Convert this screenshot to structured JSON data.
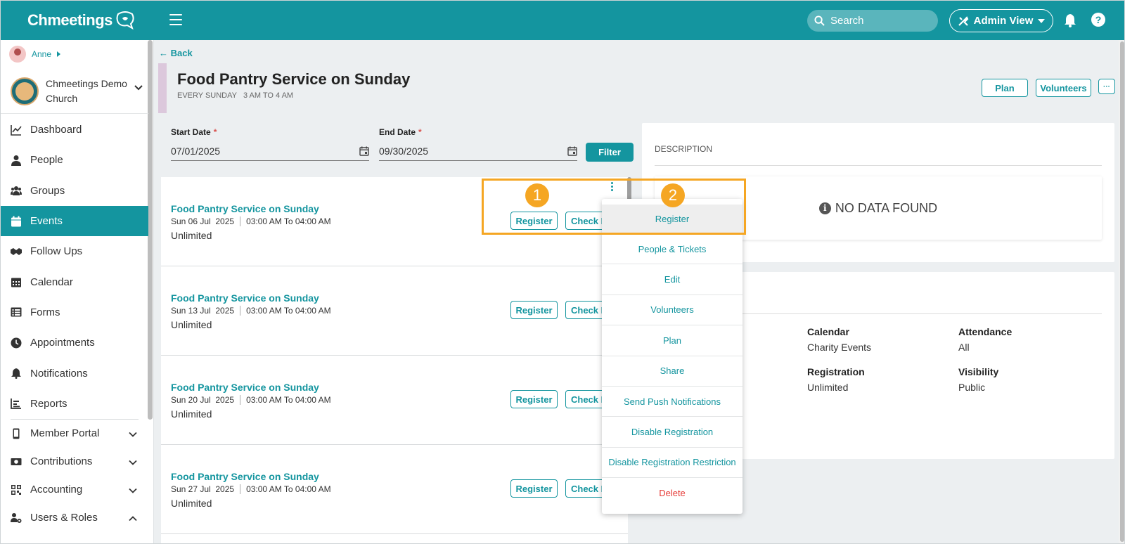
{
  "app": {
    "name": "Chmeetings"
  },
  "topbar": {
    "search_placeholder": "Search",
    "admin_view_label": "Admin View"
  },
  "user": {
    "name": "Anne"
  },
  "church": {
    "name": "Chmeetings Demo Church"
  },
  "nav": {
    "items": [
      {
        "label": "Dashboard",
        "icon": "chart-line-icon"
      },
      {
        "label": "People",
        "icon": "person-icon"
      },
      {
        "label": "Groups",
        "icon": "users-icon"
      },
      {
        "label": "Events",
        "icon": "calendar-icon",
        "active": true
      },
      {
        "label": "Follow Ups",
        "icon": "handshake-icon"
      },
      {
        "label": "Calendar",
        "icon": "calendar-grid-icon"
      },
      {
        "label": "Forms",
        "icon": "list-icon"
      },
      {
        "label": "Appointments",
        "icon": "clock-icon"
      },
      {
        "label": "Notifications",
        "icon": "bell-icon"
      },
      {
        "label": "Reports",
        "icon": "report-icon"
      }
    ],
    "sections": [
      {
        "label": "Member Portal",
        "icon": "phone-icon",
        "expanded": false
      },
      {
        "label": "Contributions",
        "icon": "money-icon",
        "expanded": false
      },
      {
        "label": "Accounting",
        "icon": "qr-icon",
        "expanded": false
      },
      {
        "label": "Users & Roles",
        "icon": "users-cog-icon",
        "expanded": true
      }
    ]
  },
  "page": {
    "back_label": "Back",
    "title": "Food Pantry Service on Sunday",
    "subtitle": "EVERY SUNDAY   3 AM TO 4 AM",
    "header_buttons": {
      "plan": "Plan",
      "volunteers": "Volunteers",
      "more": "···"
    }
  },
  "filters": {
    "start_label": "Start Date",
    "start_value": "07/01/2025",
    "end_label": "End Date",
    "end_value": "09/30/2025",
    "required_mark": "*",
    "filter_label": "Filter"
  },
  "occurrences": [
    {
      "title": "Food Pantry Service on Sunday",
      "date": "Sun 06 Jul  2025",
      "time": "03:00 AM To 04:00 AM",
      "capacity": "Unlimited"
    },
    {
      "title": "Food Pantry Service on Sunday",
      "date": "Sun 13 Jul  2025",
      "time": "03:00 AM To 04:00 AM",
      "capacity": "Unlimited"
    },
    {
      "title": "Food Pantry Service on Sunday",
      "date": "Sun 20 Jul  2025",
      "time": "03:00 AM To 04:00 AM",
      "capacity": "Unlimited"
    },
    {
      "title": "Food Pantry Service on Sunday",
      "date": "Sun 27 Jul  2025",
      "time": "03:00 AM To 04:00 AM",
      "capacity": "Unlimited"
    }
  ],
  "occurrence_buttons": {
    "register": "Register",
    "checkin": "Check I"
  },
  "description": {
    "label": "DESCRIPTION",
    "empty": "NO DATA FOUND"
  },
  "details": {
    "calendar_label": "Calendar",
    "calendar_value": "Charity Events",
    "attendance_label": "Attendance",
    "attendance_value": "All",
    "registration_label": "Registration",
    "registration_value": "Unlimited",
    "visibility_label": "Visibility",
    "visibility_value": "Public"
  },
  "dropdown": {
    "items": [
      "Register",
      "People & Tickets",
      "Edit",
      "Volunteers",
      "Plan",
      "Share",
      "Send Push Notifications",
      "Disable Registration",
      "Disable Registration Restriction",
      "Delete"
    ]
  },
  "callouts": {
    "one": "1",
    "two": "2"
  },
  "colors": {
    "brand": "#14959f",
    "highlight": "#f5a623",
    "danger": "#e53935"
  }
}
